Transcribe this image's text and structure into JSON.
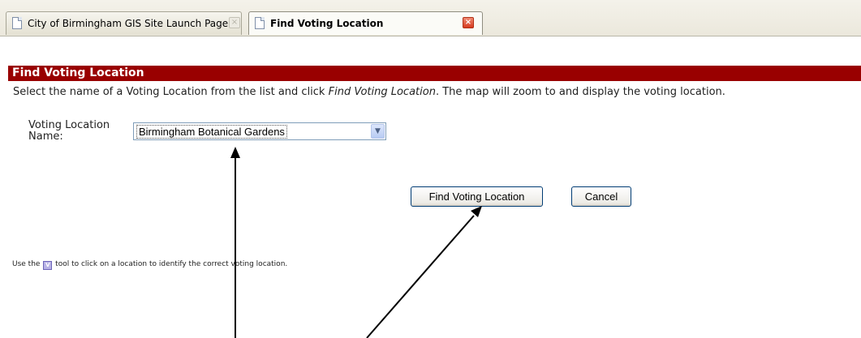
{
  "tabs": [
    {
      "label": "City of Birmingham GIS Site Launch Page",
      "active": false,
      "close_icon": "×"
    },
    {
      "label": "Find Voting Location",
      "active": true,
      "close_icon": "×"
    }
  ],
  "header": {
    "title": "Find Voting Location"
  },
  "instructions": {
    "prefix": "Select the name of a Voting Location from the list and click ",
    "emphasis": "Find Voting Location",
    "suffix": ". The map will zoom to and display the voting location."
  },
  "form": {
    "label": "Voting Location Name:",
    "selected_value": "Birmingham Botanical Gardens",
    "dropdown_icon": "▼"
  },
  "buttons": {
    "find_label": "Find Voting Location",
    "cancel_label": "Cancel"
  },
  "tip": {
    "prefix": "Use the ",
    "tool_icon": "V",
    "suffix": " tool to click on a location to identify the correct voting location."
  },
  "colors": {
    "header_band": "#990000",
    "arrow": "#000000"
  }
}
